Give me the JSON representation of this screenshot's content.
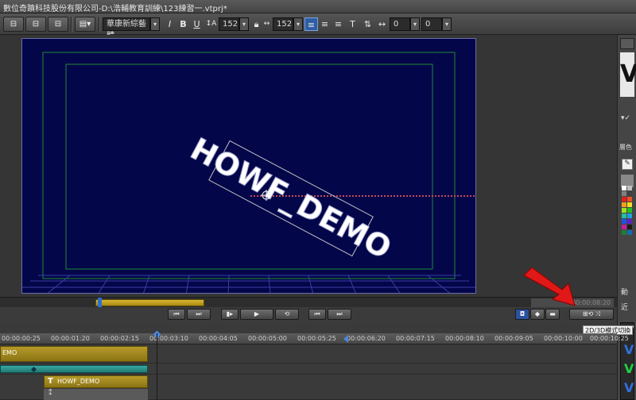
{
  "window": {
    "title": "數位奇蹟科技股份有限公司-D:\\浩輔教育訓練\\123練習一.vtprj*"
  },
  "toolbar": {
    "font_name": "華康新綜藝體",
    "italic_label": "I",
    "bold_label": "B",
    "underline_label": "U",
    "font_size": "152",
    "font_size_2": "152",
    "offset_x": "0",
    "offset_y": "0"
  },
  "preview": {
    "text": "HOWF_DEMO"
  },
  "scrub": {
    "timecode": "00:00:08:20"
  },
  "tooltip": {
    "label": "2D/3D模式切換"
  },
  "timeline": {
    "ruler": [
      "00:00:00:25",
      "00:00:01:20",
      "00:00:02:15",
      "00:00:03:10",
      "00:00:04:05",
      "00:00:05:00",
      "00:00:05:25",
      "00:00:06:20",
      "00:00:07:15",
      "00:00:08:10",
      "00:00:09:05",
      "00:00:10:00",
      "00:00:10:25"
    ],
    "clip_label_left": "EMO",
    "clip_label": "HOWF_DEMO"
  },
  "right_panel": {
    "tab_label": "層色",
    "label_a": "動",
    "label_b": "近"
  },
  "colors": {
    "canvas_bg": "#04064a",
    "safe_area": "#1e8a34",
    "accent_red": "#e01818"
  }
}
